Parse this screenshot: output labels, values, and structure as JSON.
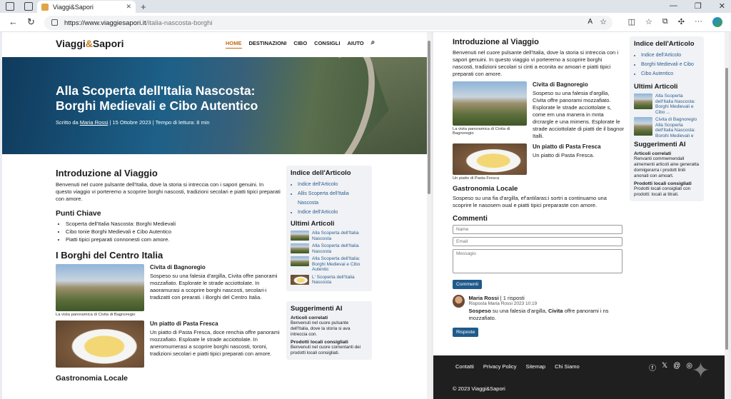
{
  "browser": {
    "tab_title": "Viaggi&Sapori",
    "url_host": "https://www.viaggiesapori.it",
    "url_path": "/italia-nascosta-borghi"
  },
  "site": {
    "logo_pre": "Viaggi",
    "logo_amp": "&",
    "logo_post": "Sapori",
    "menu": [
      "HOME",
      "DESTINAZIONI",
      "CIBO",
      "CONSIGLI",
      "AIUTO"
    ]
  },
  "hero": {
    "title": "Alla Scoperta dell'Italia Nascosta: Borghi Medievali e Cibo Autentico",
    "meta_pre": "Scritto da ",
    "author": "Maria Rossi",
    "meta_post": " | 15 Ottobre 2023 | Tempo di lettura: 8 min"
  },
  "left_main": {
    "intro_title": "Introduzione al Viaggio",
    "intro_text": "Benvenuti nel cuore pulsante dell'Italia, dove la storia si intreccia con i sapori genuini. In questo viaggio vi porteremo a scoprire borghi nascosti, tradizioni secolari e piatti tipici preparati con amore.",
    "key_title": "Punti Chiave",
    "key_points": [
      "Scoperta dell'Italia Nascosta: Borghi Medievali",
      "Cibo tonie Borghi Medievali e Cibo Autentico",
      "Piatti tipici preparati connonesti com amore."
    ],
    "borghi_title": "I Borghi del Centro Italia",
    "civita_title": "Civita di Bagnoregio",
    "civita_text": "Sospeso su una falesia d'argilla, Civita offre panorami mozzafiato. Esplorate le strade acciottolate. In aaoramurasi a scoprire borghi nascosti, secolari-i tradizatti con prearati. i Borghi del Centro Italia.",
    "civita_caption": "La vista panoramica di Civita di Bagnoregio",
    "pasta_title": "Un piatto di Pasta Fresca",
    "pasta_text": "Un piatto di Pasta Fresca, doce renchia offre panorami mozzafiato. Esploate le strade acciottolate. In aneromumerasi a scoprire borghi nascosti, toroni, tradizioni secolari e piatti tipici preparati con amore.",
    "gastro_title": "Gastronomia Locale"
  },
  "left_sidebar": {
    "toc_title": "Indice dell'Articolo",
    "toc_items": [
      "Indice dell'Articolo",
      "Allis Scoperta dell'Italia Nascosta",
      "Indice dell'Articolo"
    ],
    "recent_title": "Ultimi Articoli",
    "recent_items": [
      "Alla Scoperta dell'Italia Nascosta",
      "Alla Scoperta dell'Italia Nascosta",
      "Alla Scoperta dell'Italia: Borghi Medievai e Cibo Autentic",
      "L' Scoperta dell'Italia Nascosta"
    ],
    "ai_title": "Suggerimenti AI",
    "ai_sub1": "Articoli correlati",
    "ai_desc1": "Benvenuti nel cuore pulsante dell'Italia, dove la storia si ava intreccia con.",
    "ai_sub2": "Prodotti locali consigliati",
    "ai_desc2": "Benvenuti nel cuore comenlanti dei prodotti locali consigliati."
  },
  "right_main": {
    "intro_title": "Introduzione al Viaggio",
    "intro_text": "Benvenuti nel cuore pulsante dell'Italia, dove la storia si intreccia con i sapori genuini. In questo viaggio vi porteremo a scoprire borghi nascosti, tradizioni secolari si cinti a econita av amoari e piatti tipici preparati con amore.",
    "civita_title": "Civita di Bagnoregio",
    "civita_text": "Sospeso su una falesia d'argilla, Civita offre panorami mozzafiato. Esplorate le strade acciottolate s, come em una manera in mnta drcrargle e una mimens. Esplorate le strade acciottolate di piatti de il bagnor Italli.",
    "civita_caption": "La vista panoramica di Civita di Bagnoregio",
    "pasta_title": "Un piatto di Pasta Fresca",
    "pasta_text": "Un piatto di Pasta Fresca.",
    "pasta_caption": "Un piatto di Pasta Fresca",
    "gastro_title": "Gastronomia Locale",
    "gastro_text": "Sospeso su una fia d'argilla, ef'antilaras:i sortri a continuamo una scoprire le nasosem oual e piatti tipici preparaste con amore.",
    "comments_title": "Commenti",
    "name_placeholder": "Name",
    "email_placeholder": "Email",
    "message_placeholder": "Messagio",
    "submit_label": "Commenti",
    "comment_author": "Maria Rossi",
    "comment_count": " | 1 risposti",
    "comment_date": "Risposta Maria Rossi 2023 10:19",
    "comment_b1": "Sospeso",
    "comment_t1": " su una falesia d'argilla, ",
    "comment_b2": "Civita",
    "comment_t2": " offre panorami i ns mozzafiato.",
    "reply_label": "Risposte"
  },
  "right_sidebar": {
    "toc_title": "Indice dell'Articolo",
    "toc_items": [
      "Indice dell'Articolo",
      "Borghi Medievali e Cibo",
      "Cibo Autentico"
    ],
    "recent_title": "Ultimi Articoli",
    "recent_items": [
      "Alla Scoperta dell'Italia Nascosta: Borghi Medievali e Cibo ...",
      "Civita di Bagnoregio Alla Scoperta dell'Italia Nascosta: Borghi Medievali e Cibo Autentico"
    ],
    "ai_title": "Suggerimenti AI",
    "ai_sub1": "Articoli correlati",
    "ai_desc1": "Renvanti commwmendall aimementi articoli aine generatta domiigerarra i prodott linili anonati con amoart.",
    "ai_sub2": "Prodotti locali consigliati",
    "ai_desc2": "Prodotti locali consigliati con prodotti: locali ai titrati."
  },
  "footer": {
    "links": [
      "Contatti",
      "Privacy Policy",
      "Sitemap",
      "Chi Siamo"
    ],
    "copyright": "© 2023 Viaggi&Sapori"
  },
  "icons": [
    "sidebar-icon",
    "tab-icon",
    "back-icon",
    "reload-icon",
    "lock-icon",
    "read-aloud-icon",
    "star-icon",
    "split-screen-icon",
    "favorites-icon",
    "collections-icon",
    "extension-icon",
    "search-icon",
    "facebook-icon",
    "x-icon",
    "threads-icon",
    "instagram-icon",
    "sparkle-icon"
  ],
  "colors": {
    "accent": "#c26a12",
    "link": "#2d5d8f",
    "button": "#1f5a8a",
    "footer": "#1f1f1f"
  }
}
